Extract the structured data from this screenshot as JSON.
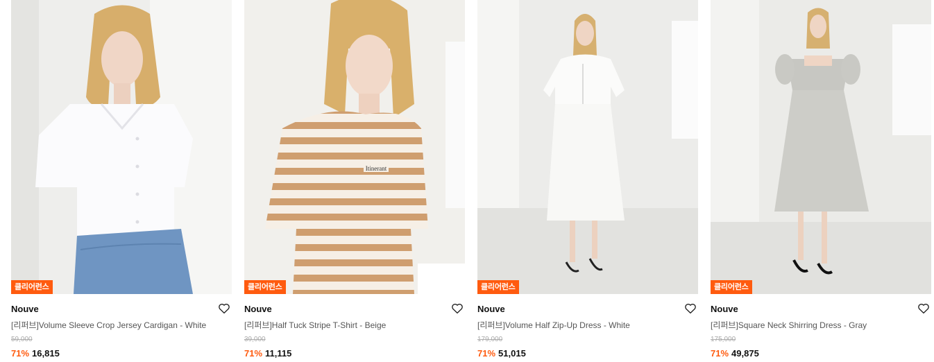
{
  "accent": "#ff5b0f",
  "products": [
    {
      "badge": "클리어런스",
      "brand": "Nouve",
      "name": "[리퍼브]Volume Sleeve Crop Jersey Cardigan - White",
      "original_price": "59,000",
      "discount": "71%",
      "price": "16,815",
      "wish_icon": "heart-outline-icon"
    },
    {
      "badge": "클리어런스",
      "brand": "Nouve",
      "name": "[리퍼브]Half Tuck Stripe T-Shirt - Beige",
      "original_price": "39,000",
      "discount": "71%",
      "price": "11,115",
      "wish_icon": "heart-outline-icon"
    },
    {
      "badge": "클리어런스",
      "brand": "Nouve",
      "name": "[리퍼브]Volume Half Zip-Up Dress - White",
      "original_price": "179,000",
      "discount": "71%",
      "price": "51,015",
      "wish_icon": "heart-outline-icon"
    },
    {
      "badge": "클리어런스",
      "brand": "Nouve",
      "name": "[리퍼브]Square Neck Shirring Dress - Gray",
      "original_price": "175,000",
      "discount": "71%",
      "price": "49,875",
      "wish_icon": "heart-outline-icon"
    }
  ]
}
